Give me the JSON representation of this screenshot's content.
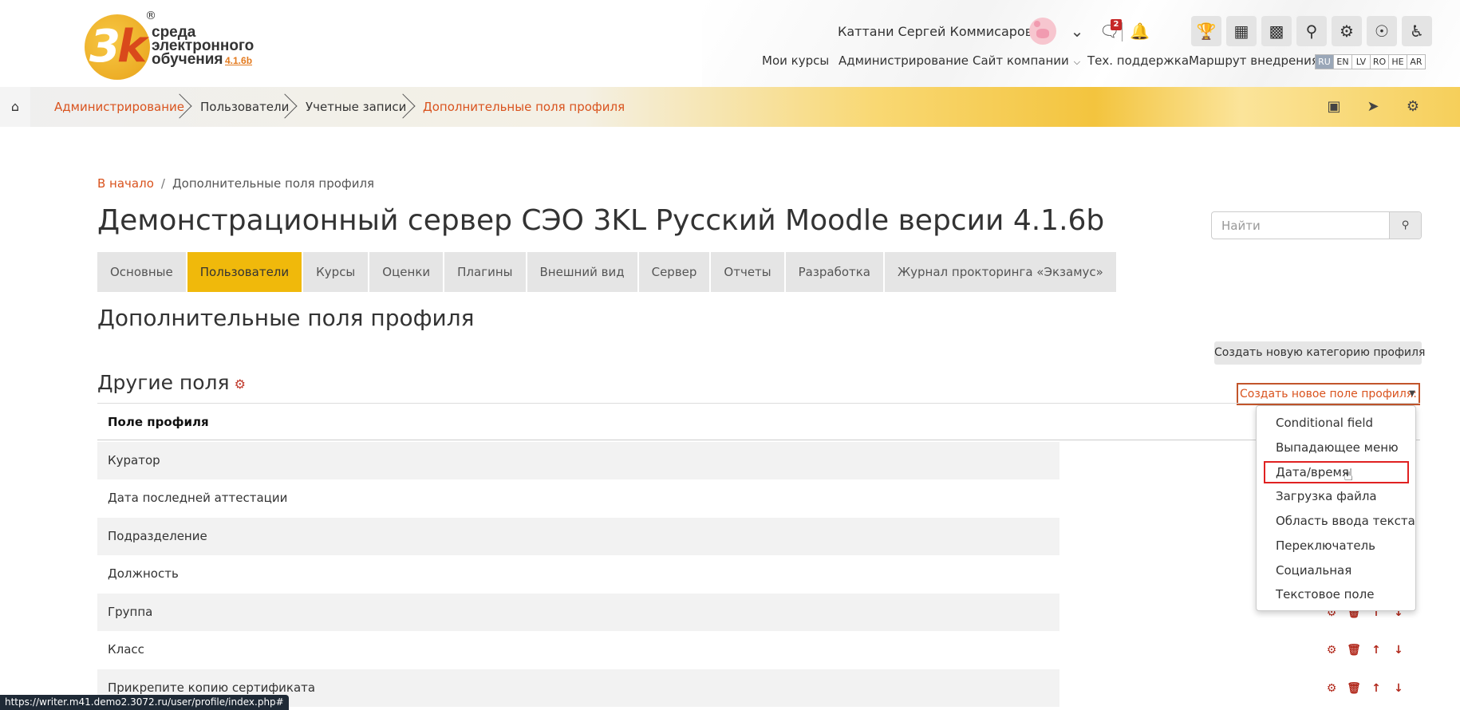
{
  "header": {
    "logo_text_line1": "среда",
    "logo_text_line2": "электронного",
    "logo_text_line3": "обучения",
    "logo_version": "4.1.6b",
    "logo_reg": "®",
    "user_name": "Каттани Сергей Коммисарович",
    "messages_badge": "2",
    "nav": {
      "my_courses": "Мои курсы",
      "administration": "Администрирование",
      "company_site": "Сайт компании",
      "support": "Тех. поддержка",
      "route": "Маршрут внедрения"
    },
    "languages": [
      "RU",
      "EN",
      "LV",
      "RO",
      "HE",
      "AR"
    ],
    "active_language": "RU"
  },
  "crumbbar": {
    "items": [
      "Администрирование",
      "Пользователи",
      "Учетные записи",
      "Дополнительные поля профиля"
    ]
  },
  "pathbar": {
    "home": "В начало",
    "separator": "/",
    "current": "Дополнительные поля профиля"
  },
  "page": {
    "title": "Демонстрационный сервер СЭО 3KL Русский Moodle версии 4.1.6b",
    "search_placeholder": "Найти",
    "section_title": "Дополнительные поля профиля",
    "new_category_button": "Создать новую категорию профиля",
    "category_title": "Другие поля",
    "create_field_select": "Создать новое поле профиля:",
    "table_header": "Поле профиля"
  },
  "tabs": [
    {
      "label": "Основные",
      "active": false
    },
    {
      "label": "Пользователи",
      "active": true
    },
    {
      "label": "Курсы",
      "active": false
    },
    {
      "label": "Оценки",
      "active": false
    },
    {
      "label": "Плагины",
      "active": false
    },
    {
      "label": "Внешний вид",
      "active": false
    },
    {
      "label": "Сервер",
      "active": false
    },
    {
      "label": "Отчеты",
      "active": false
    },
    {
      "label": "Разработка",
      "active": false
    },
    {
      "label": "Журнал прокторинга «Экзамус»",
      "active": false
    }
  ],
  "rows": [
    "Куратор",
    "Дата последней аттестации",
    "Подразделение",
    "Должность",
    "Группа",
    "Класс",
    "Прикрепите копию сертификата"
  ],
  "dropdown": {
    "options": [
      "Conditional field",
      "Выпадающее меню",
      "Дата/время",
      "Загрузка файла",
      "Область ввода текста",
      "Переключатель",
      "Социальная",
      "Текстовое поле"
    ],
    "highlighted": "Дата/время"
  },
  "statusbar": {
    "url": "https://writer.m41.demo2.3072.ru/user/profile/index.php#"
  },
  "colors": {
    "accent": "#d9531e",
    "active_tab": "#f0b90b",
    "action_icons": "#b22a1d",
    "highlight_border": "#e02121"
  }
}
